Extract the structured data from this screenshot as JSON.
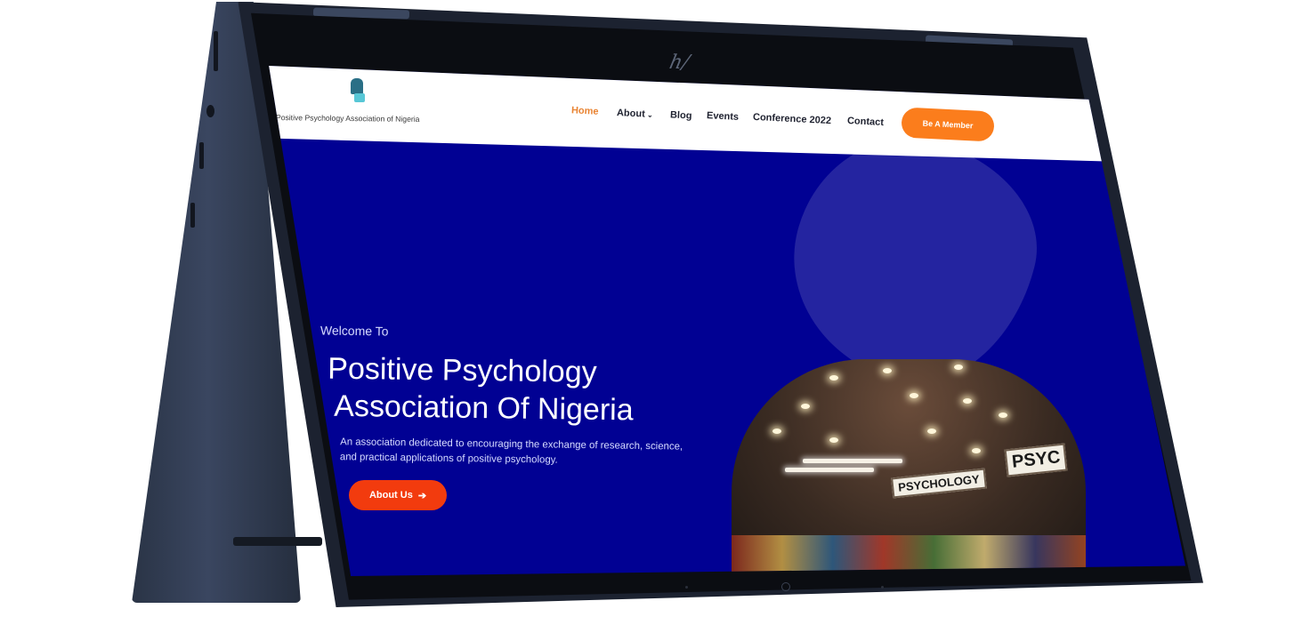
{
  "header": {
    "org_name": "Positive Psychology Association of Nigeria",
    "nav": [
      {
        "label": "Home",
        "active": true
      },
      {
        "label": "About"
      },
      {
        "label": "Blog"
      },
      {
        "label": "Events"
      },
      {
        "label": "Conference 2022"
      },
      {
        "label": "Contact"
      }
    ],
    "cta": "Be A Member"
  },
  "hero": {
    "welcome": "Welcome To",
    "title": "Positive Psychology\n Association Of Nigeria",
    "description": "An association dedicated to encouraging the exchange of research, science, and practical applications of positive psychology.",
    "button": "About Us",
    "photo_signs": [
      "PSYCHOLOGY",
      "PSYC"
    ]
  },
  "colors": {
    "hero_bg": "#010193",
    "accent_orange": "#fb7d1c",
    "button_red": "#f23b0e",
    "active_nav": "#e98433"
  },
  "icons": {
    "dropdown": "chevron-down-icon",
    "arrow": "arrow-right-icon"
  }
}
